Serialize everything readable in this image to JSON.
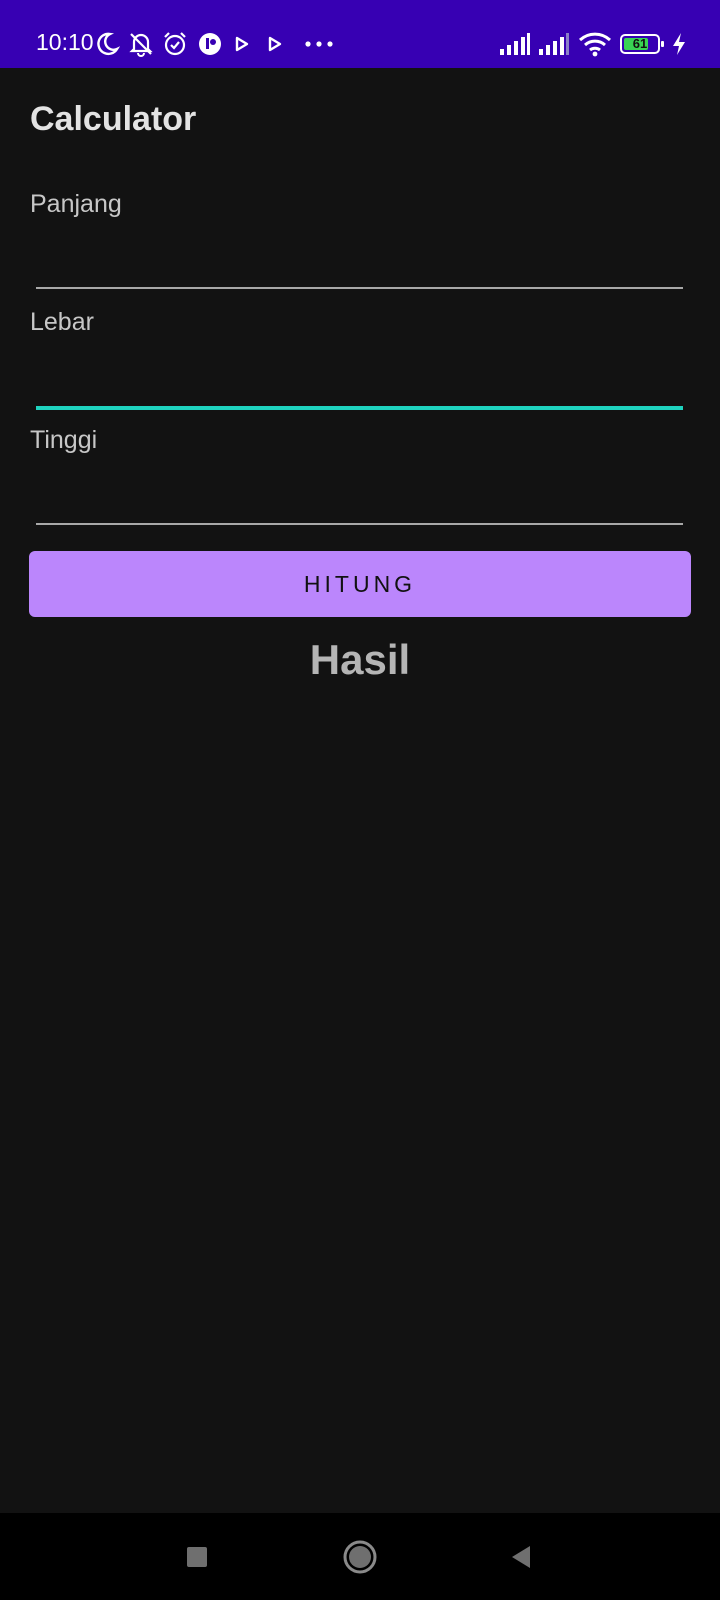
{
  "status_bar": {
    "time": "10:10",
    "battery_level": "61",
    "background_color": "#3700b3",
    "icons": [
      "moon-icon",
      "bell-off-icon",
      "alarm-icon",
      "app-notification-icon",
      "play-icon",
      "play-icon",
      "more-dots-icon",
      "signal-icon",
      "signal-icon",
      "wifi-icon",
      "battery-icon",
      "charging-icon"
    ]
  },
  "app": {
    "title": "Calculator"
  },
  "form": {
    "panjang": {
      "label": "Panjang",
      "value": ""
    },
    "lebar": {
      "label": "Lebar",
      "value": ""
    },
    "tinggi": {
      "label": "Tinggi",
      "value": ""
    }
  },
  "button": {
    "label": "HITUNG",
    "color": "#bb86fc"
  },
  "result": {
    "text": "Hasil"
  },
  "colors": {
    "background": "#121212",
    "focus_accent": "#1fd3bf"
  },
  "navigation": {
    "buttons": [
      "recents-square-icon",
      "home-circle-icon",
      "back-triangle-icon"
    ]
  }
}
